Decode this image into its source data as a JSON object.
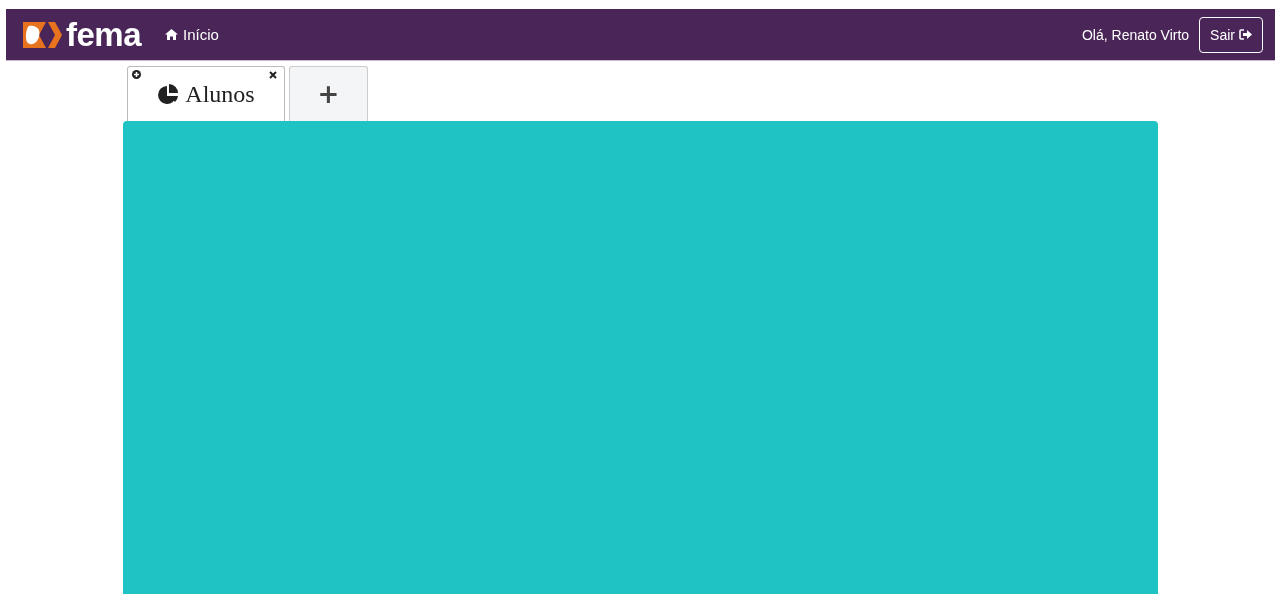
{
  "navbar": {
    "logo": "fema",
    "home_link": "Início",
    "greeting": "Olá, Renato Virto",
    "logout_button": "Sair"
  },
  "tabs": [
    {
      "kind": "page",
      "label": "Alunos",
      "selected": true
    },
    {
      "kind": "add",
      "label": "+",
      "selected": false
    }
  ]
}
